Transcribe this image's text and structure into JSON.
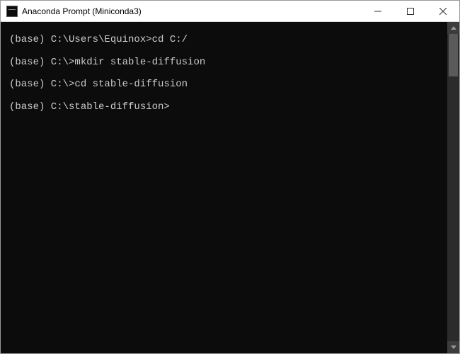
{
  "window": {
    "title": "Anaconda Prompt (Miniconda3)"
  },
  "terminal": {
    "lines": [
      {
        "prompt": "(base) C:\\Users\\Equinox>",
        "command": "cd C:/"
      },
      {
        "prompt": "(base) C:\\>",
        "command": "mkdir stable-diffusion"
      },
      {
        "prompt": "(base) C:\\>",
        "command": "cd stable-diffusion"
      },
      {
        "prompt": "(base) C:\\stable-diffusion>",
        "command": ""
      }
    ]
  }
}
